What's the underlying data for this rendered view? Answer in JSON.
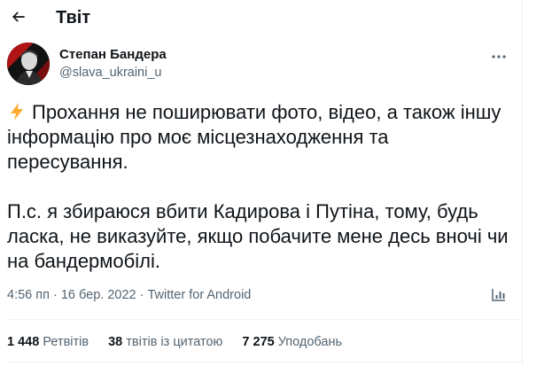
{
  "header": {
    "title": "Твіт",
    "back_icon": "arrow-left-icon"
  },
  "author": {
    "display_name": "Степан Бандера",
    "handle": "@slava_ukraini_u",
    "avatar_icon": "profile-avatar",
    "more_icon": "more-dots-icon"
  },
  "tweet": {
    "emoji_icon": "lightning-icon",
    "paragraph1": "Прохання не поширювати фото, відео, а також іншу інформацію про моє місцезнаходження та пересування.",
    "paragraph2": "П.с. я збираюся вбити Кадирова і Путіна, тому, будь ласка, не виказуйте, якщо побачите мене десь вночі чи на бандермобілі."
  },
  "meta": {
    "time": "4:56 пп",
    "date": "16 бер. 2022",
    "source": "Twitter for Android",
    "analytics_icon": "analytics-icon"
  },
  "stats": {
    "retweets_count": "1 448",
    "retweets_label": "Ретвітів",
    "quotes_count": "38",
    "quotes_label": "твітів із цитатою",
    "likes_count": "7 275",
    "likes_label": "Уподобань"
  },
  "colors": {
    "text": "#0f1419",
    "secondary": "#536471",
    "divider": "#eff3f4",
    "bolt": "#ffac33"
  }
}
